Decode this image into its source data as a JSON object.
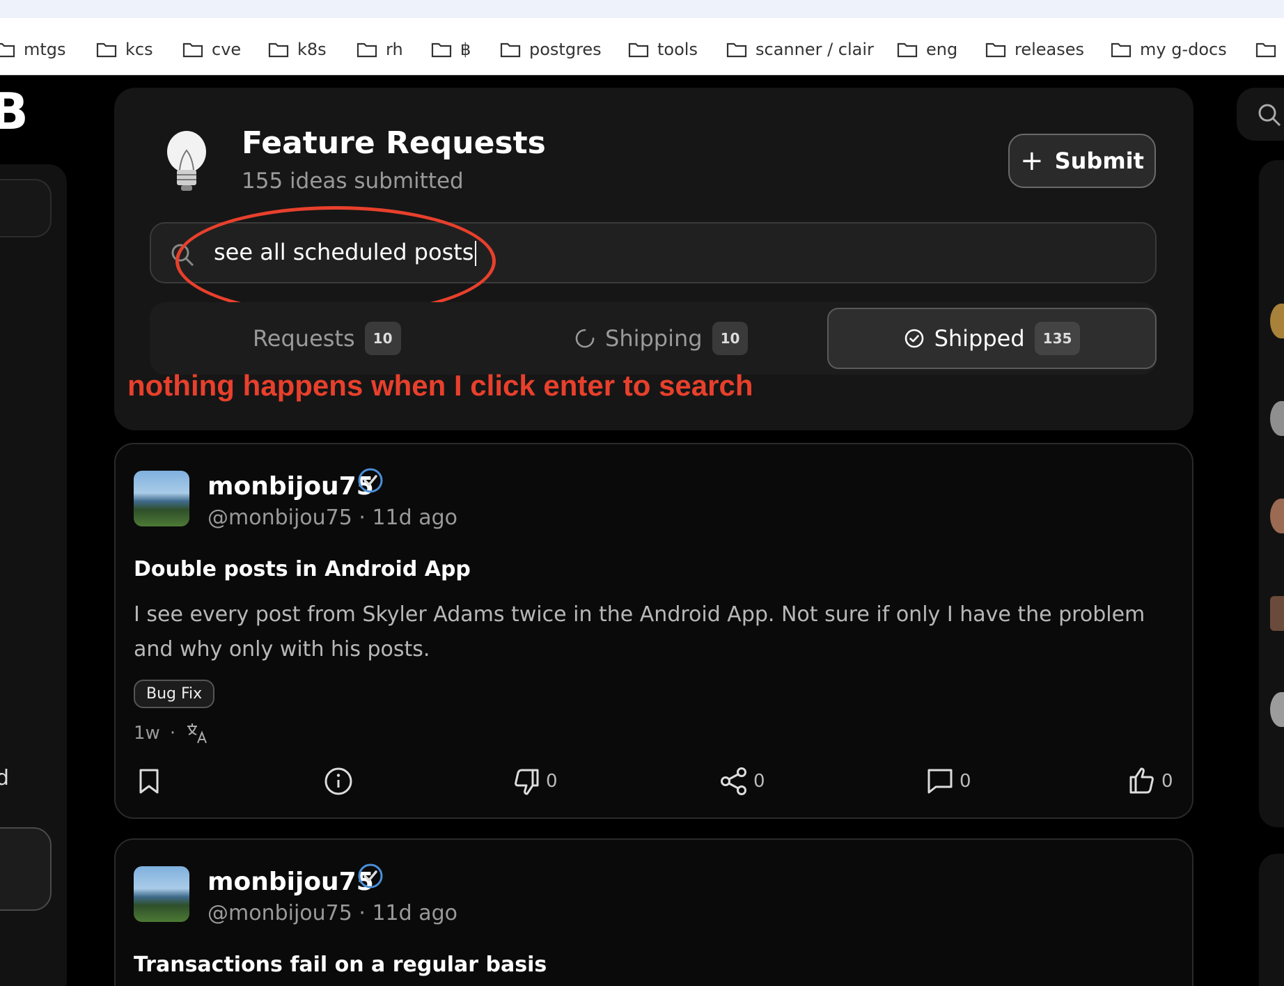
{
  "bookmarks": [
    "mtgs",
    "kcs",
    "cve",
    "k8s",
    "rh",
    "฿",
    "postgres",
    "tools",
    "scanner / clair",
    "eng",
    "releases",
    "my g-docs"
  ],
  "left_rail": {
    "logo_fragment": "B",
    "item_fragment": "d"
  },
  "header": {
    "title": "Feature Requests",
    "subtitle": "155 ideas submitted",
    "submit_label": "Submit",
    "submit_icon": "+"
  },
  "search": {
    "value": "see all scheduled posts"
  },
  "tabs": [
    {
      "label": "Requests",
      "count": "10",
      "active": false
    },
    {
      "label": "Shipping",
      "count": "10",
      "active": false
    },
    {
      "label": "Shipped",
      "count": "135",
      "active": true
    }
  ],
  "annotation": {
    "text": "nothing happens when I click enter to search",
    "color": "#e8402c"
  },
  "posts": [
    {
      "username": "monbijou75",
      "handle": "@monbijou75",
      "time": "11d ago",
      "title": "Double posts in Android App",
      "body": "I see every post from Skyler Adams twice in the Android App. Not sure if only I have the problem and why only with his posts.",
      "tag": "Bug Fix",
      "age": "1w",
      "dislikes": "0",
      "shares": "0",
      "comments": "0",
      "likes": "0"
    },
    {
      "username": "monbijou75",
      "handle": "@monbijou75",
      "time": "11d ago",
      "title": "Transactions fail on a regular basis"
    }
  ]
}
